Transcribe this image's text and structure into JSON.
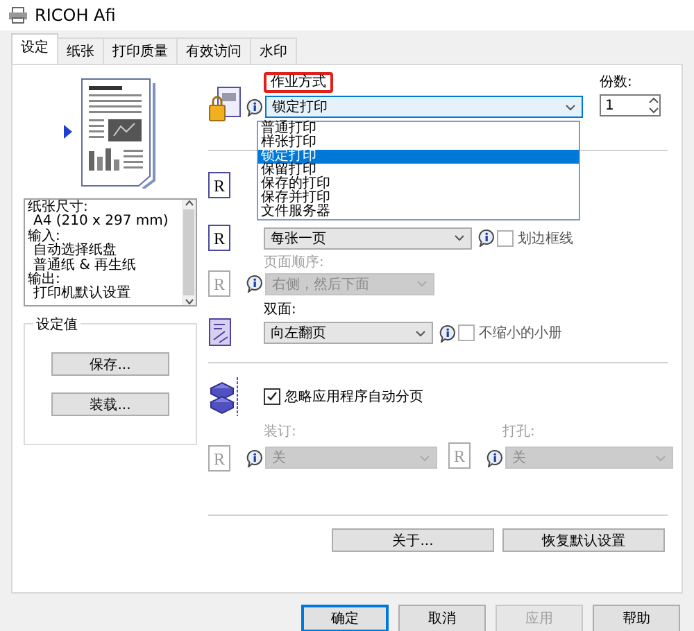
{
  "window": {
    "title": "RICOH Afi"
  },
  "tabs": [
    {
      "label": "设定",
      "selected": true
    },
    {
      "label": "纸张",
      "selected": false
    },
    {
      "label": "打印质量",
      "selected": false
    },
    {
      "label": "有效访问",
      "selected": false
    },
    {
      "label": "水印",
      "selected": false
    }
  ],
  "summary": {
    "items": [
      {
        "label": "纸张尺寸:",
        "children": [
          {
            "label": "A4 (210 x 297 mm)"
          }
        ]
      },
      {
        "label": "输入:",
        "children": [
          {
            "label": "自动选择纸盘"
          },
          {
            "label": "普通纸 & 再生纸"
          }
        ]
      },
      {
        "label": "输出:",
        "children": [
          {
            "label": "打印机默认设置"
          }
        ]
      }
    ]
  },
  "presets": {
    "title": "设定值",
    "buttons": [
      "保存...",
      "装载..."
    ]
  },
  "job_type": {
    "label": "作业方式",
    "highlighted": true,
    "value": "锁定打印",
    "expanded": true,
    "options": [
      {
        "label": "普通打印",
        "selected": false
      },
      {
        "label": "样张打印",
        "selected": false
      },
      {
        "label": "锁定打印",
        "selected": true
      },
      {
        "label": "保留打印",
        "selected": false
      },
      {
        "label": "保存的打印",
        "selected": false
      },
      {
        "label": "保存并打印",
        "selected": false
      },
      {
        "label": "文件服务器",
        "selected": false
      }
    ]
  },
  "copies": {
    "label": "份数:",
    "value": "1"
  },
  "covered_row": {
    "icon": "R"
  },
  "layout": {
    "icon": "R",
    "value": "每张一页",
    "check": {
      "label": "划边框线",
      "checked": false
    }
  },
  "page_order": {
    "label": "页面顺序:",
    "icon": "R",
    "value": "右侧，然后下面",
    "disabled": true
  },
  "duplex": {
    "label": "双面:",
    "value": "向左翻页",
    "check": {
      "label": "不缩小的小册",
      "checked": false
    }
  },
  "collate": {
    "label": "忽略应用程序自动分页",
    "checked": true
  },
  "staple": {
    "label": "装订:",
    "icon": "R",
    "value": "关",
    "disabled": true
  },
  "punch": {
    "label": "打孔:",
    "icon": "R",
    "value": "关",
    "disabled": true
  },
  "panel_buttons": [
    "关于...",
    "恢复默认设置"
  ],
  "buttons": [
    {
      "label": "确定",
      "default": true,
      "disabled": false
    },
    {
      "label": "取消",
      "default": false,
      "disabled": false
    },
    {
      "label": "应用",
      "default": false,
      "disabled": true
    },
    {
      "label": "帮助",
      "default": false,
      "disabled": false
    }
  ]
}
